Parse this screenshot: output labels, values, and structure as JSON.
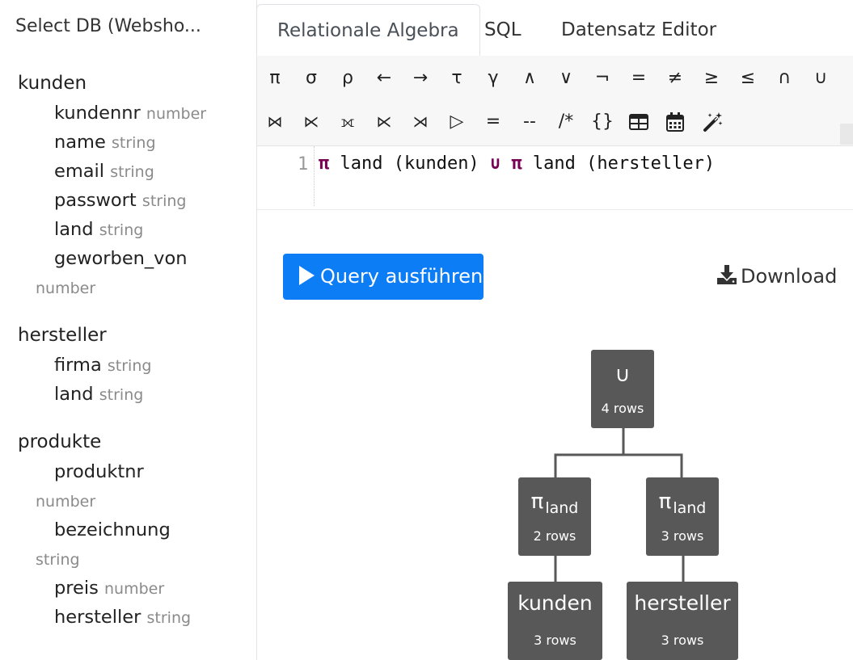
{
  "sidebar": {
    "db_select": "Select DB (Websho...",
    "tables": [
      {
        "name": "kunden",
        "columns": [
          {
            "name": "kundennr",
            "type": "number"
          },
          {
            "name": "name",
            "type": "string"
          },
          {
            "name": "email",
            "type": "string"
          },
          {
            "name": "passwort",
            "type": "string"
          },
          {
            "name": "land",
            "type": "string"
          },
          {
            "name": "geworben_von",
            "type": "number"
          }
        ]
      },
      {
        "name": "hersteller",
        "columns": [
          {
            "name": "firma",
            "type": "string"
          },
          {
            "name": "land",
            "type": "string"
          }
        ]
      },
      {
        "name": "produkte",
        "columns": [
          {
            "name": "produktnr",
            "type": "number"
          },
          {
            "name": "bezeichnung",
            "type": "string"
          },
          {
            "name": "preis",
            "type": "number"
          },
          {
            "name": "hersteller",
            "type": "string"
          }
        ]
      }
    ],
    "trailing": "."
  },
  "tabs": [
    "Relationale Algebra",
    "SQL",
    "Datensatz Editor"
  ],
  "toolbar": {
    "row1": [
      "π",
      "σ",
      "ρ",
      "←",
      "→",
      "τ",
      "γ",
      "∧",
      "∨",
      "¬",
      "=",
      "≠",
      "≥",
      "≤",
      "∩",
      "∪"
    ],
    "row2": [
      "⋈",
      "⋉",
      "⟗",
      "⋉",
      "⋊",
      "▷",
      "=",
      "--",
      "/*",
      "{}"
    ],
    "icons": [
      "table-icon",
      "calendar-icon",
      "magic-wand-icon"
    ]
  },
  "editor": {
    "line_number": "1",
    "tokens": [
      {
        "text": "π",
        "kw": true
      },
      {
        "text": " land (kunden) ",
        "kw": false
      },
      {
        "text": "∪",
        "kw": true
      },
      {
        "text": " ",
        "kw": false
      },
      {
        "text": "π",
        "kw": true
      },
      {
        "text": " land (hersteller)",
        "kw": false
      }
    ]
  },
  "actions": {
    "run_label": "Query ausführen",
    "download_label": "Download"
  },
  "tree": {
    "union": {
      "op": "∪",
      "rows": "4 rows"
    },
    "proj_left": {
      "op": "π",
      "sub": "land",
      "rows": "2 rows"
    },
    "proj_right": {
      "op": "π",
      "sub": "land",
      "rows": "3 rows"
    },
    "kunden": {
      "op": "kunden",
      "rows": "3 rows"
    },
    "hersteller": {
      "op": "hersteller",
      "rows": "3 rows"
    }
  },
  "colors": {
    "primary": "#0d7df6",
    "node": "#585858",
    "keyword": "#7a0054"
  }
}
